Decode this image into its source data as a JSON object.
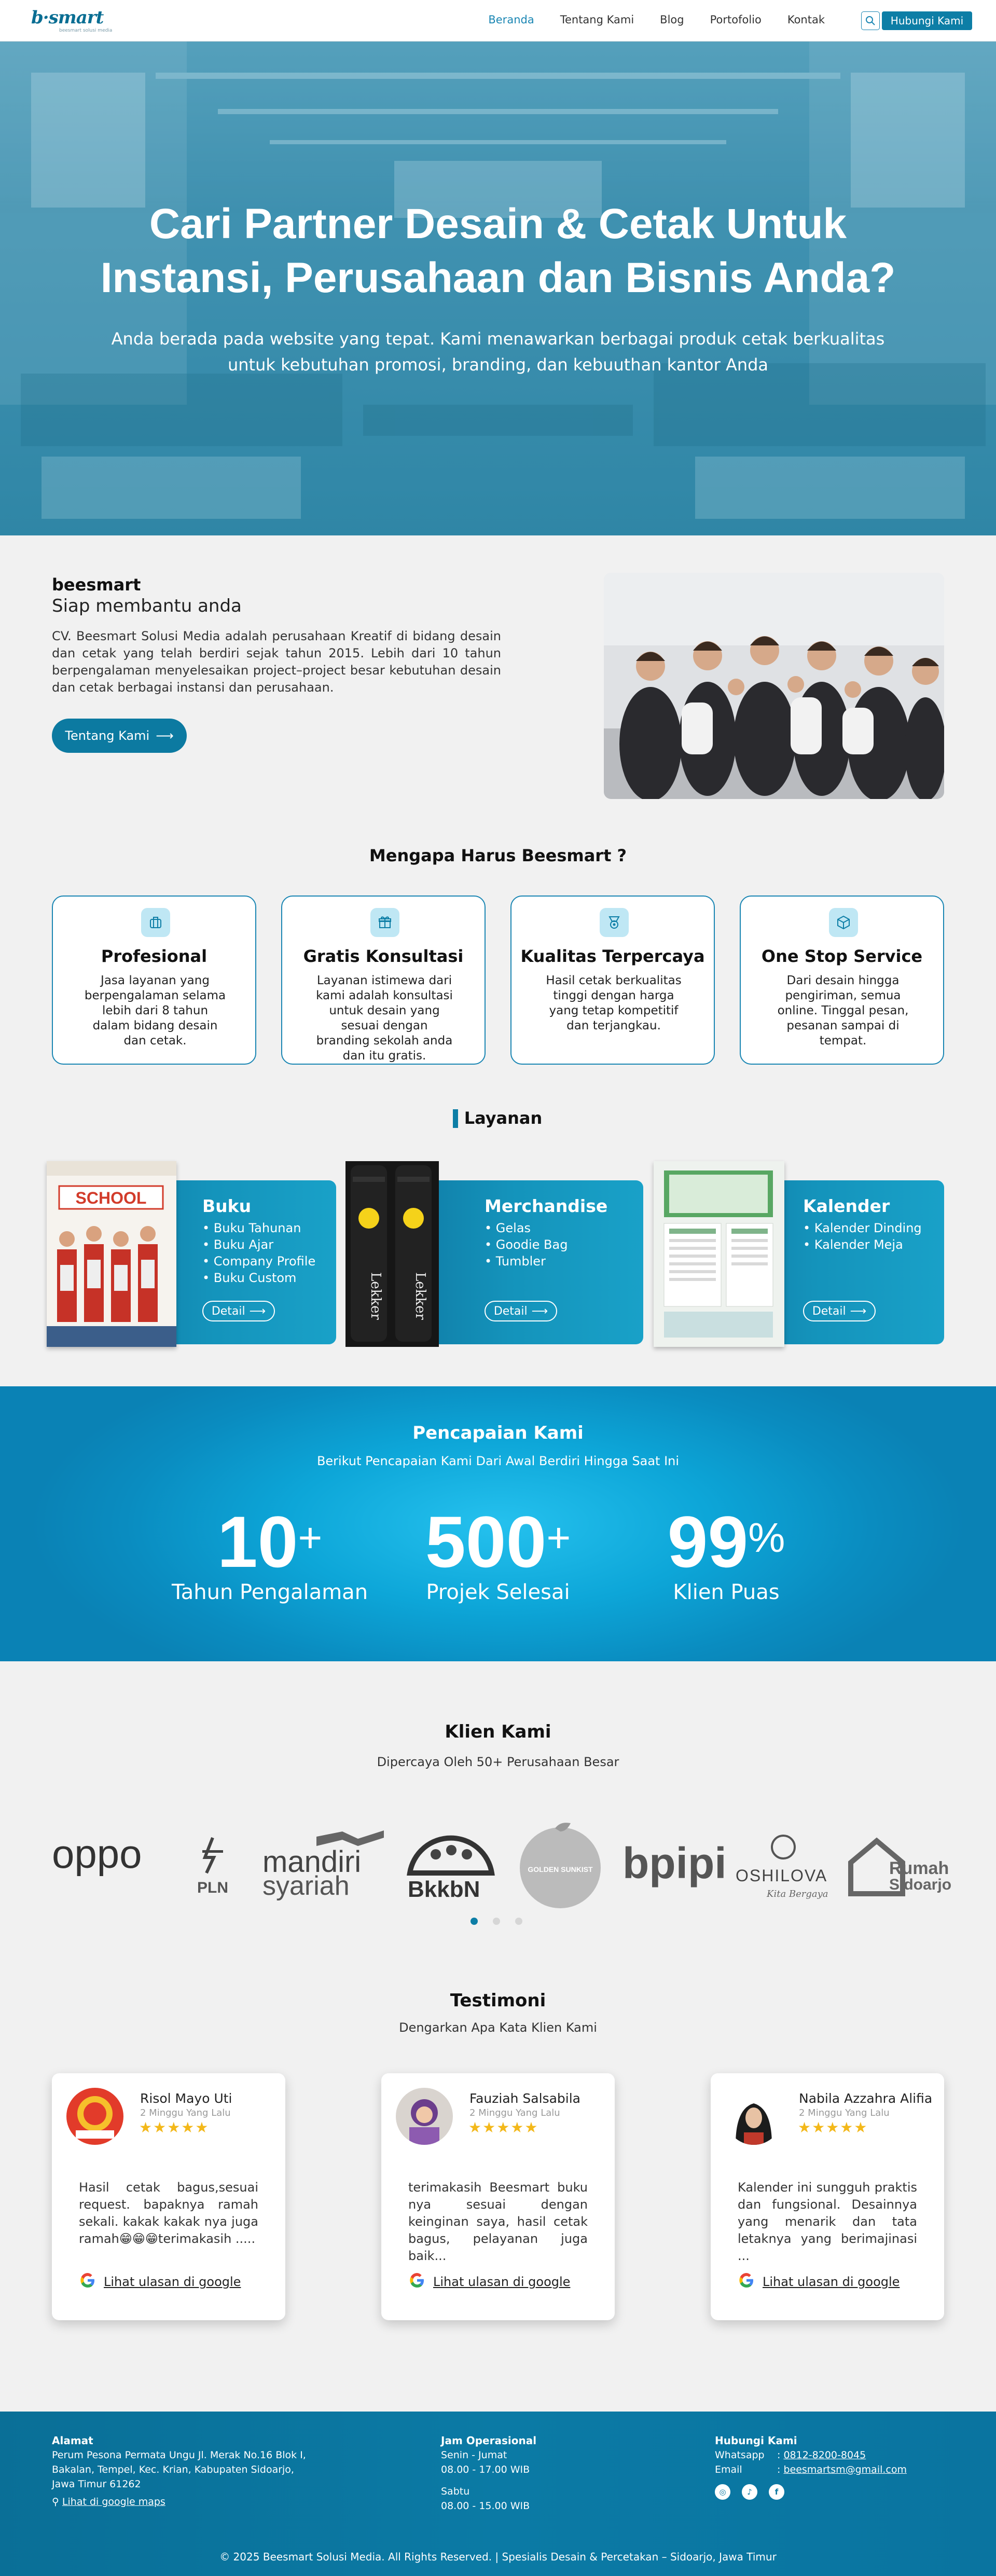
{
  "nav": {
    "logo": "b·smart",
    "logo_tagline": "beesmart solusi media",
    "links": [
      "Beranda",
      "Tentang Kami",
      "Blog",
      "Portofolio",
      "Kontak"
    ],
    "cta": "Hubungi Kami"
  },
  "hero": {
    "title_line1": "Cari Partner Desain & Cetak Untuk",
    "title_line2": "Instansi, Perusahaan dan Bisnis Anda?",
    "subtitle_line1": "Anda berada pada website yang tepat. Kami menawarkan berbagai produk cetak berkualitas",
    "subtitle_line2": "untuk kebutuhan promosi, branding, dan kebuuthan kantor Anda"
  },
  "about": {
    "name": "beesmart",
    "tagline": "Siap membantu anda",
    "text": "CV. Beesmart Solusi Media adalah perusahaan Kreatif di bidang desain dan cetak yang telah berdiri sejak tahun 2015. Lebih dari 10 tahun berpengalaman menyelesaikan project–project besar kebutuhan desain dan cetak berbagai instansi dan perusahaan.",
    "button": "Tentang Kami"
  },
  "why": {
    "title": "Mengapa Harus Beesmart ?",
    "cards": [
      {
        "title": "Profesional",
        "text": "Jasa layanan yang berpengalaman selama lebih dari 8 tahun dalam bidang desain dan cetak.",
        "icon": "briefcase-icon"
      },
      {
        "title": "Gratis Konsultasi",
        "text": "Layanan istimewa dari kami adalah konsultasi untuk desain yang sesuai dengan branding sekolah anda dan itu gratis.",
        "icon": "gift-icon"
      },
      {
        "title": "Kualitas Terpercaya",
        "text": "Hasil cetak berkualitas tinggi dengan harga yang tetap kompetitif dan terjangkau.",
        "icon": "medal-icon"
      },
      {
        "title": "One Stop Service",
        "text": "Dari desain hingga pengiriman, semua online. Tinggal pesan, pesanan sampai di tempat.",
        "icon": "box-icon"
      }
    ]
  },
  "services": {
    "title": "Layanan",
    "items": [
      {
        "title": "Buku",
        "bullets": [
          "Buku Tahunan",
          "Buku Ajar",
          "Company Profile",
          "Buku Custom"
        ],
        "button": "Detail"
      },
      {
        "title": "Merchandise",
        "bullets": [
          "Gelas",
          "Goodie Bag",
          "Tumbler"
        ],
        "button": "Detail"
      },
      {
        "title": "Kalender",
        "bullets": [
          "Kalender Dinding",
          "Kalender Meja"
        ],
        "button": "Detail"
      }
    ],
    "book_cover_text": "SCHOOL",
    "tumbler_text": "Lekker"
  },
  "achievements": {
    "title": "Pencapaian Kami",
    "subtitle": "Berikut Pencapaian Kami Dari Awal Berdiri Hingga Saat Ini",
    "stats": [
      {
        "number": "10",
        "suffix": "+",
        "label": "Tahun Pengalaman"
      },
      {
        "number": "500",
        "suffix": "+",
        "label": "Projek Selesai"
      },
      {
        "number": "99",
        "suffix": "%",
        "label": "Klien Puas"
      }
    ]
  },
  "clients": {
    "title": "Klien Kami",
    "subtitle": "Dipercaya Oleh 50+ Perusahaan Besar",
    "logos": {
      "oppo": "oppo",
      "pln": "PLN",
      "mandiri1": "mandiri",
      "mandiri2": "syariah",
      "bkkbn": "BkkbN",
      "golden": "GOLDEN SUNKIST",
      "bpipi": "bpipi",
      "oshilova": "OSHILOVA",
      "oshilova_sub": "Kita Bergaya",
      "rumah1": "Rumah",
      "rumah2": "Sidoarjo"
    }
  },
  "testimonials": {
    "title": "Testimoni",
    "subtitle": "Dengarkan Apa Kata Klien Kami",
    "stars": "★★★★★",
    "link": "Lihat ulasan di google",
    "items": [
      {
        "name": "Risol Mayo Uti",
        "time": "2 Minggu Yang Lalu",
        "text": "Hasil cetak bagus,sesuai request. bapaknya ramah sekali. kakak kakak nya juga ramah😁😁😁terimakasih ....."
      },
      {
        "name": "Fauziah Salsabila",
        "time": "2 Minggu Yang Lalu",
        "text": "terimakasih Beesmart buku nya sesuai dengan keinginan saya, hasil cetak bagus, pelayanan juga baik..."
      },
      {
        "name": "Nabila Azzahra Alifia",
        "time": "2 Minggu Yang Lalu",
        "text": "Kalender ini sungguh praktis dan fungsional. Desainnya yang menarik dan tata letaknya yang berimajinasi ..."
      }
    ]
  },
  "footer": {
    "address_title": "Alamat",
    "address": "Perum Pesona Permata Ungu Jl. Merak No.16 Blok I, Bakalan, Tempel, Kec. Krian, Kabupaten Sidoarjo, Jawa Timur 61262",
    "maps_link": "Lihat di google maps",
    "hours_title": "Jam Operasional",
    "weekday": "Senin - Jumat",
    "weekday_hours": "08.00 - 17.00 WIB",
    "saturday": "Sabtu",
    "saturday_hours": "08.00 - 15.00 WIB",
    "contact_title": "Hubungi Kami",
    "wa_label": "Whatsapp",
    "wa_value": "0812-8200-8045",
    "email_label": "Email",
    "email_value": "beesmartsm@gmail.com",
    "copyright": "© 2025 Beesmart Solusi Media. All Rights Reserved. | Spesialis Desain & Percetakan – Sidoarjo, Jawa Timur"
  },
  "colors": {
    "primary": "#0d7ea6",
    "accent_light": "#bfe7f4",
    "star": "#f3b81a"
  }
}
